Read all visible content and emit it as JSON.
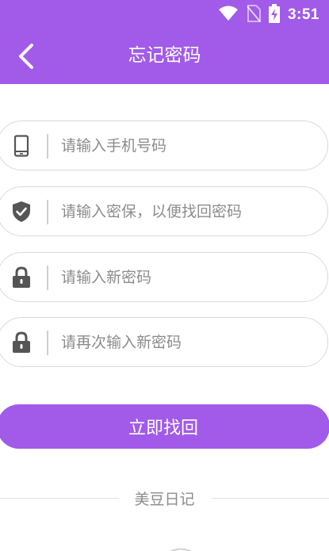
{
  "status_bar": {
    "time": "3:51",
    "icons": [
      "wifi-icon",
      "no-sim-icon",
      "battery-charging-icon"
    ]
  },
  "header": {
    "title": "忘记密码",
    "back_icon": "chevron-left-icon"
  },
  "form": {
    "phone": {
      "placeholder": "请输入手机号码",
      "value": "",
      "icon": "phone-icon"
    },
    "security_answer": {
      "placeholder": "请输入密保，以便找回密码",
      "value": "",
      "icon": "shield-check-icon"
    },
    "new_password": {
      "placeholder": "请输入新密码",
      "value": "",
      "icon": "lock-icon"
    },
    "confirm_password": {
      "placeholder": "请再次输入新密码",
      "value": "",
      "icon": "lock-icon"
    }
  },
  "actions": {
    "submit_label": "立即找回"
  },
  "footer": {
    "label": "美豆日记"
  },
  "colors": {
    "accent": "#a15be8",
    "field_border": "#d9d9d9",
    "placeholder": "#8c8c8c",
    "icon": "#555555"
  }
}
